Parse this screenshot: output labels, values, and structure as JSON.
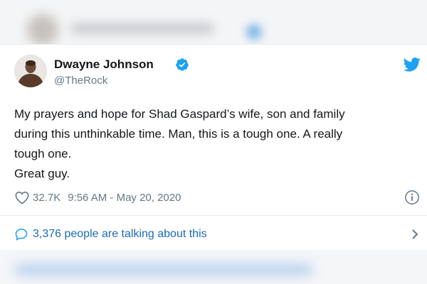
{
  "tweet": {
    "author_name": "Dwayne Johnson",
    "handle": "@TheRock",
    "verified": true,
    "text_lines": [
      "My prayers and hope for Shad Gaspard’s wife, son and family",
      "during this unthinkable time. Man, this is a tough one. A really",
      "tough one.",
      "Great guy."
    ],
    "likes": "32.7K",
    "timestamp": "9:56 AM - May 20, 2020",
    "talking_about": "3,376 people are talking about this"
  },
  "icons": {
    "verified": "verified-badge-icon",
    "brand": "twitter-bird-icon",
    "like": "heart-icon",
    "info": "info-icon",
    "reply": "speech-bubble-icon",
    "more": "chevron-right-icon"
  },
  "colors": {
    "accent": "#1da1f2",
    "link": "#1b6bb3",
    "muted": "#657786",
    "text": "#14171a"
  }
}
